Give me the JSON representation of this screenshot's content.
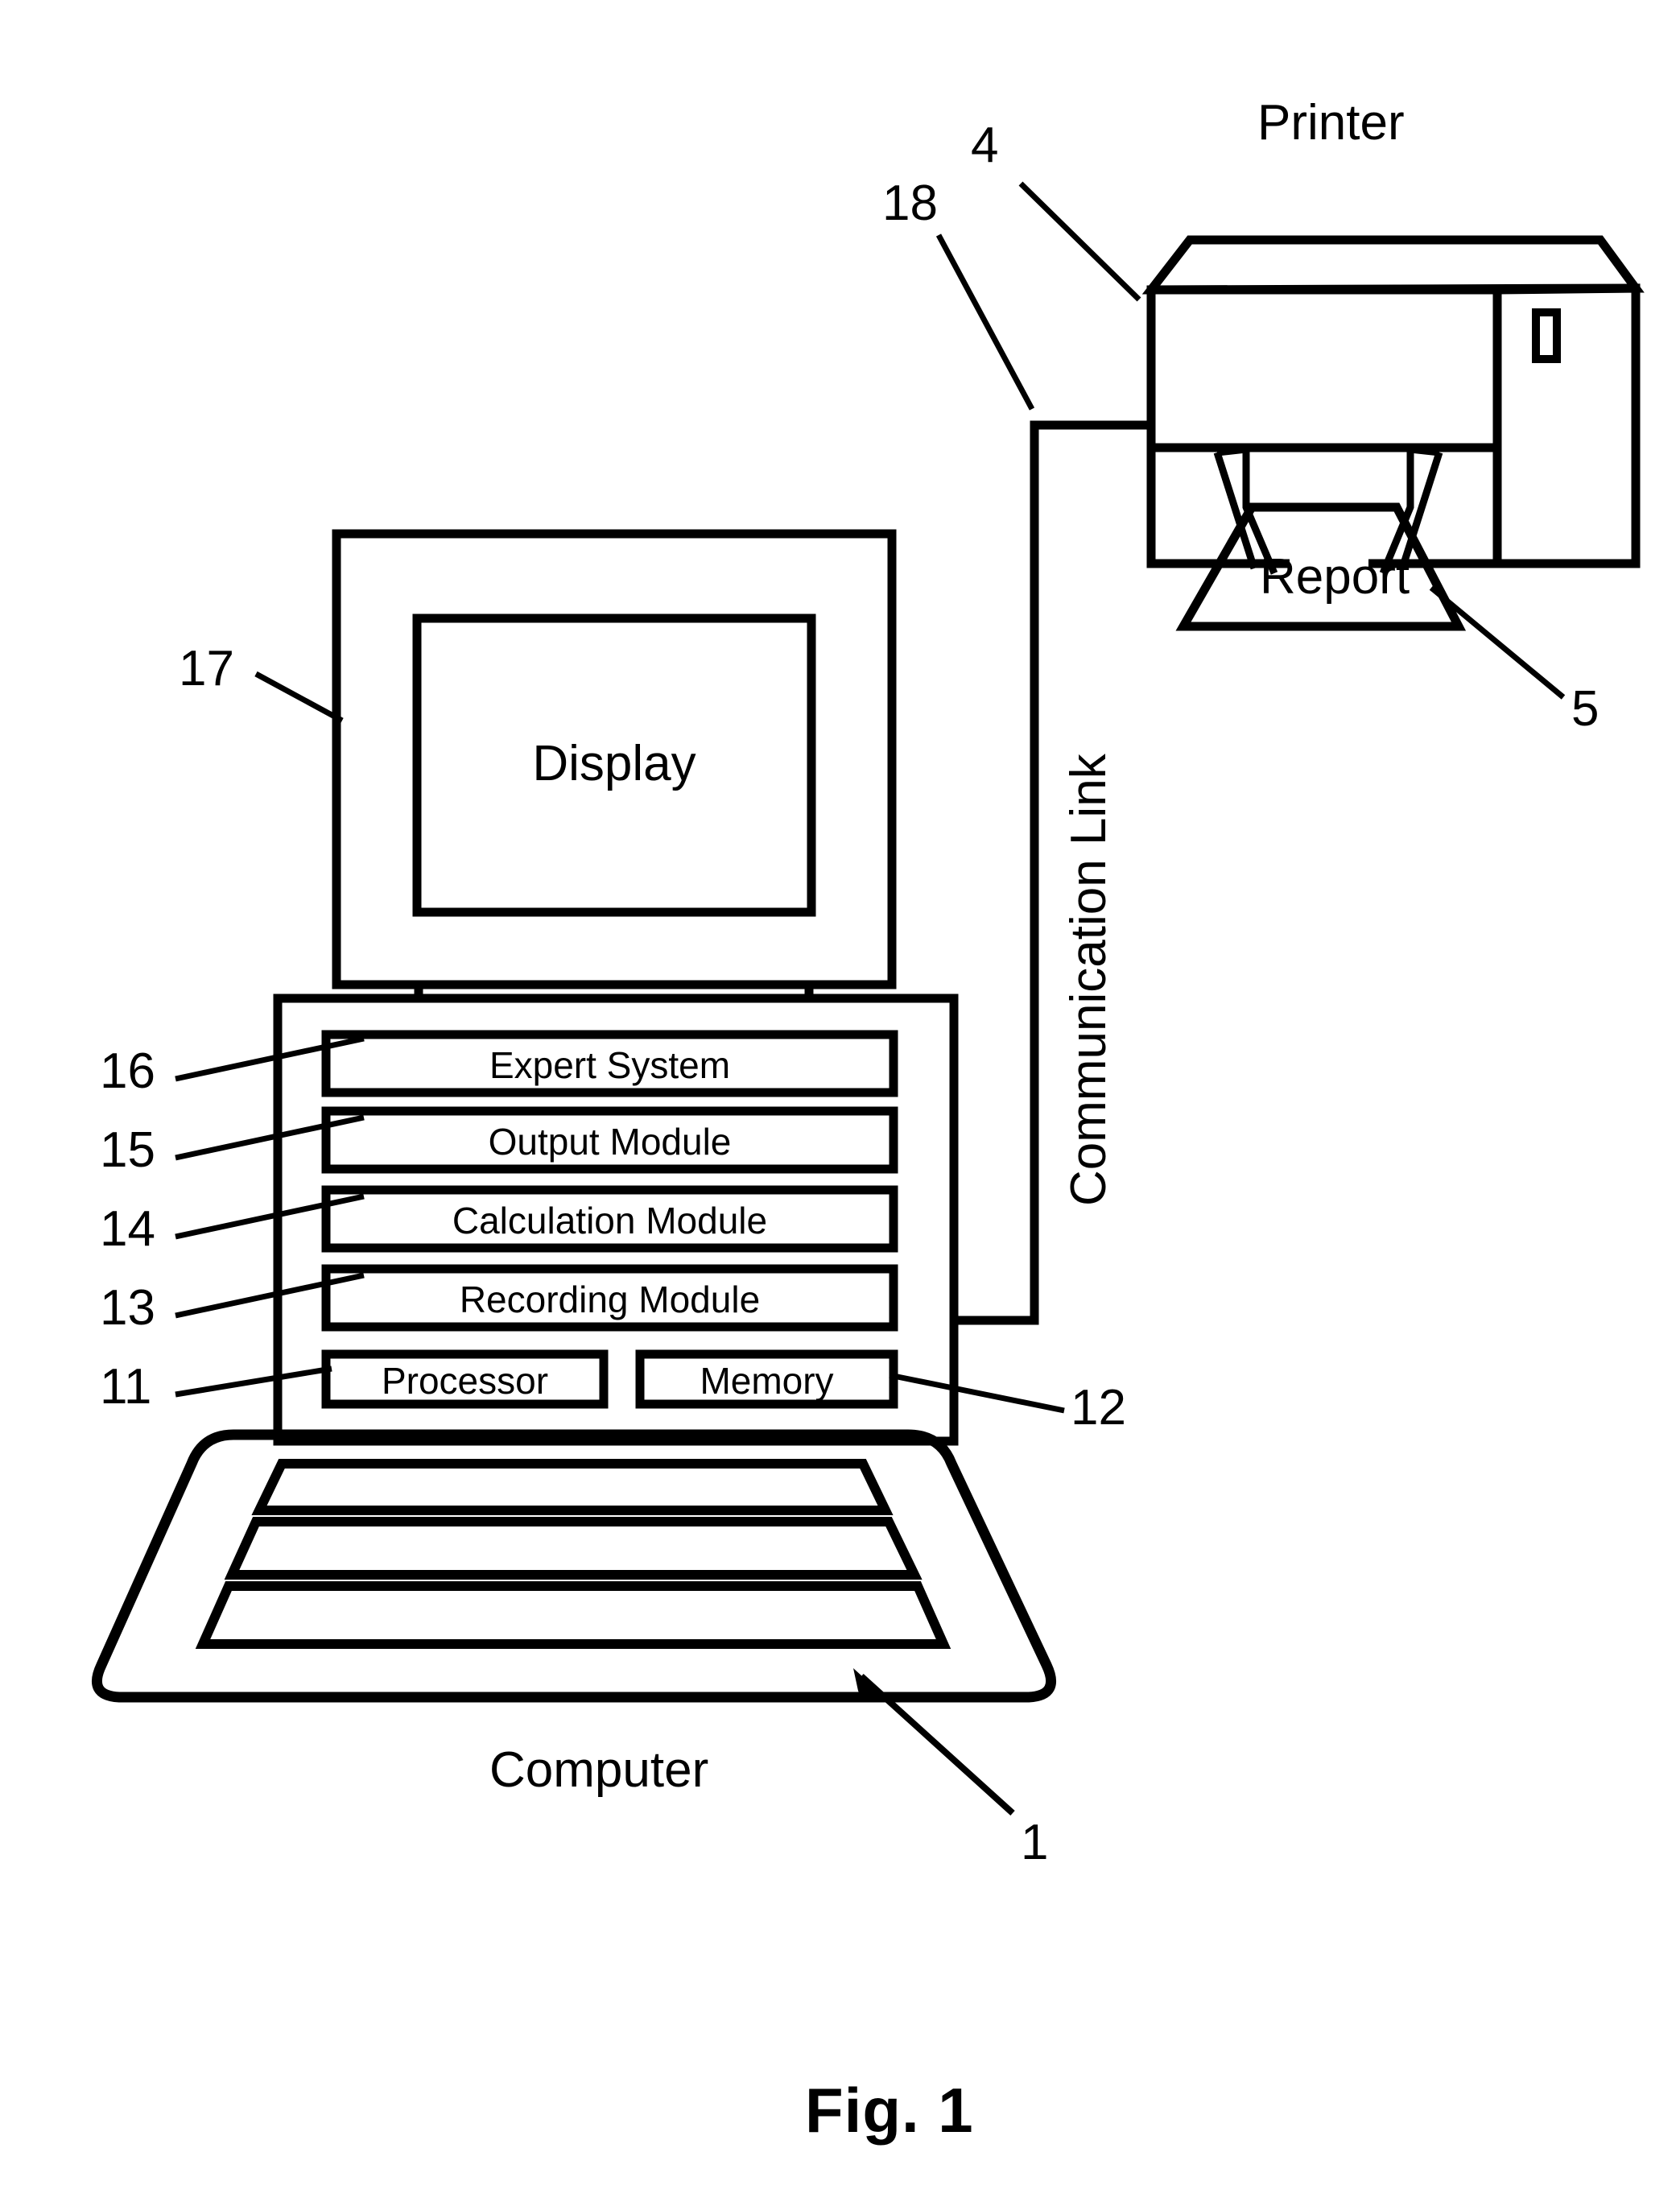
{
  "figure": {
    "caption": "Fig. 1",
    "type": "patent-line-drawing",
    "description": "Block diagram of a computer connected to a printer via a communication link"
  },
  "nodes": {
    "printer": {
      "label": "Printer",
      "ref": "4"
    },
    "report": {
      "label": "Report",
      "ref": "5"
    },
    "communication_link": {
      "label": "Communication Link",
      "ref": "18",
      "orientation": "vertical"
    },
    "display": {
      "label": "Display",
      "ref": "17"
    },
    "computer": {
      "label": "Computer",
      "ref": "1"
    }
  },
  "modules": [
    {
      "label": "Expert System",
      "ref": "16"
    },
    {
      "label": "Output Module",
      "ref": "15"
    },
    {
      "label": "Calculation Module",
      "ref": "14"
    },
    {
      "label": "Recording Module",
      "ref": "13"
    }
  ],
  "hardware": [
    {
      "label": "Processor",
      "ref": "11"
    },
    {
      "label": "Memory",
      "ref": "12"
    }
  ],
  "reference_numerals": [
    "1",
    "4",
    "5",
    "11",
    "12",
    "13",
    "14",
    "15",
    "16",
    "17",
    "18"
  ],
  "colors": {
    "ink": "#000000",
    "background": "#ffffff"
  }
}
